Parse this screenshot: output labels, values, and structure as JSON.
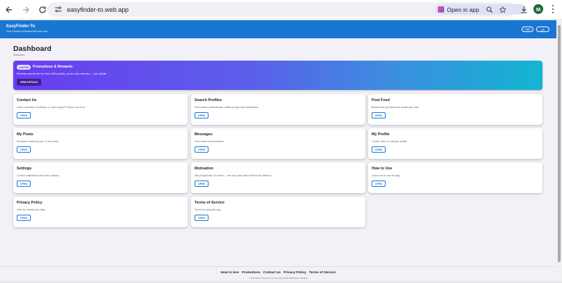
{
  "browser": {
    "url": "easyfinder-to.web.app",
    "open_in_app": "Open in app",
    "profile_initial": "M"
  },
  "header": {
    "brand": "EasyFinder-To",
    "tagline": "Find trusted professionals near you",
    "login_label": "Login",
    "lang_label": "ع/E"
  },
  "page": {
    "title": "Dashboard",
    "subtitle": "Welcome"
  },
  "promo": {
    "chip": "LIMITED",
    "title": "Promotions & Rewards",
    "description": "Monthly rewards for the first 1000 profiles, posts, and referrals — see details.",
    "button": "VIEW DETAILS"
  },
  "cards": [
    {
      "title": "Contact Us",
      "description": "Have a question, feedback, or need support? Reach out to us.",
      "button": "OPEN"
    },
    {
      "title": "Search Profiles",
      "description": "Find nearby professionals, skilled people and businesses.",
      "button": "OPEN"
    },
    {
      "title": "Post Feed",
      "description": "Browse the post feed and create your own.",
      "button": "OPEN"
    },
    {
      "title": "My Posts",
      "description": "All posts created by you, in one place.",
      "button": "OPEN"
    },
    {
      "title": "Messages",
      "description": "Your recent conversations.",
      "button": "OPEN"
    },
    {
      "title": "My Profile",
      "description": "Create, view, or edit your profile.",
      "button": "OPEN"
    },
    {
      "title": "Settings",
      "description": "Control notifications and more options.",
      "button": "OPEN"
    },
    {
      "title": "Motivation",
      "description": "Why EasyFinder-To exists — the story and vision behind the platform.",
      "button": "OPEN"
    },
    {
      "title": "How to Use",
      "description": "Learn how to use the app.",
      "button": "OPEN"
    },
    {
      "title": "Privacy Policy",
      "description": "How we handle your data.",
      "button": "OPEN"
    },
    {
      "title": "Terms of Service",
      "description": "Terms for using the app.",
      "button": "OPEN"
    }
  ],
  "footer": {
    "links": [
      "How to Use",
      "Promotions",
      "Contact Us",
      "Privacy Policy",
      "Terms of Service"
    ],
    "copyright": "© 2025 EDG. Engineering Life Living (EMD PRIVATE LIMITED)"
  },
  "colors": {
    "brand_blue": "#1976d2",
    "promo_start": "#6a3cf0",
    "promo_end": "#12b6d2",
    "background": "#f3f1f8"
  }
}
